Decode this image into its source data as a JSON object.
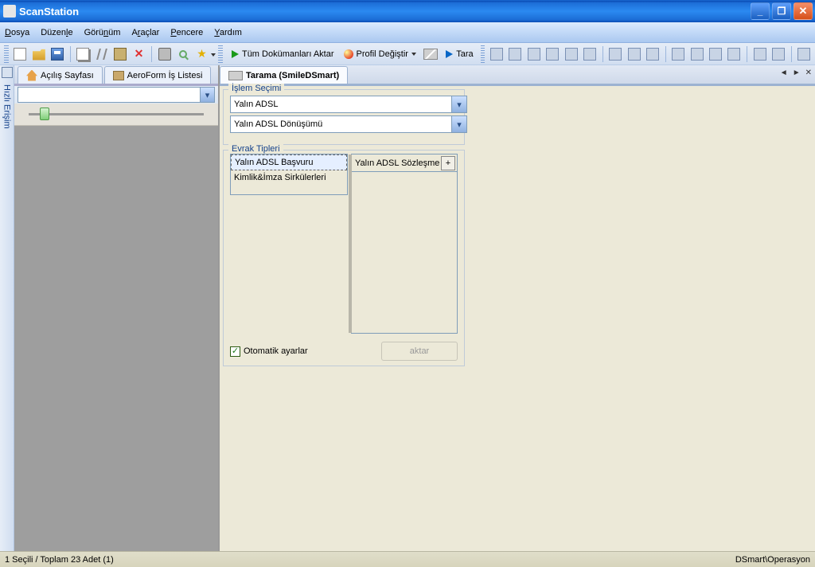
{
  "title": "ScanStation",
  "menu": {
    "dosya": "Dosya",
    "duzenle": "Düzenle",
    "gorunum": "Görünüm",
    "araclar": "Araçlar",
    "pencere": "Pencere",
    "yardim": "Yardım"
  },
  "toolbar2": {
    "tum_aktar": "Tüm Dokümanları Aktar",
    "profil": "Profil Değiştir",
    "tara": "Tara"
  },
  "sidebar_label": "Hızlı Erişim",
  "left_tabs": {
    "home": "Açılış Sayfası",
    "list": "AeroForm İş Listesi"
  },
  "main_tab": "Tarama (SmileDSmart)",
  "group1": {
    "legend": "İşlem Seçimi",
    "sel1": "Yalın ADSL",
    "sel2": "Yalın ADSL Dönüşümü"
  },
  "group2": {
    "legend": "Evrak Tipleri",
    "left_items": [
      "Yalın ADSL Başvuru",
      "Kimlik&İmza Sirkülerleri"
    ],
    "right_tab": "Yalın ADSL Sözleşme",
    "plus": "+",
    "chk_label": "Otomatik ayarlar",
    "btn": "aktar"
  },
  "status": {
    "left": "1 Seçili / Toplam 23 Adet (1)",
    "right": "DSmart\\Operasyon"
  }
}
